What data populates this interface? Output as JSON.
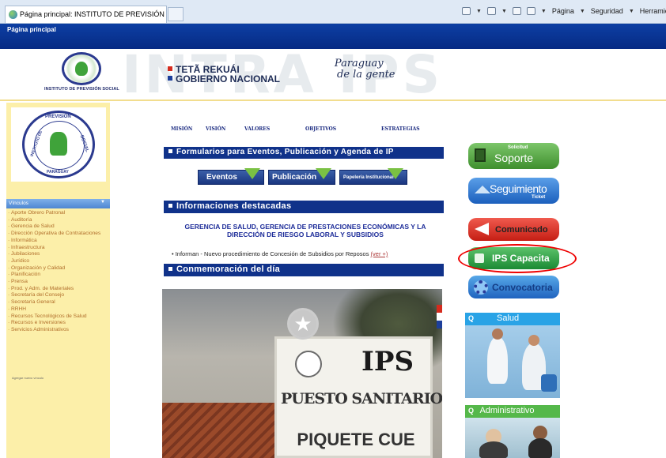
{
  "browser": {
    "tab_title": "Página principal: INSTITUTO DE PREVISIÓN SOCI...",
    "menu": [
      "Página",
      "Seguridad",
      "Herramientas"
    ],
    "frame_title": "Página principal"
  },
  "header": {
    "logo_caption": "INSTITUTO DE PREVISIÓN SOCIAL",
    "watermark": "INTRA IPS",
    "gov_line1": "TETÃ REKUÁI",
    "gov_line2": "GOBIERNO NACIONAL",
    "slogan_line1": "Paraguay",
    "slogan_line2": "de la gente",
    "colors": {
      "red": "#d52b1e",
      "blue": "#1d3f9b"
    }
  },
  "sidebar": {
    "seal_top": "PREVISIÓN",
    "seal_left": "INSTITUTO DE",
    "seal_right": "SOCIAL",
    "seal_bottom": "PARAGUAY",
    "links_title": "Vínculos",
    "links": [
      "Aporte Obrero Patronal",
      "Auditoría",
      "Gerencia de Salud",
      "Dirección Operativa de Contrataciones",
      "Informática",
      "Infraestructura",
      "Jubilaciones",
      "Jurídico",
      "Organización y Calidad",
      "Planificación",
      "Prensa",
      "Prod. y Adm. de Materiales",
      "Secretaría del Consejo",
      "Secretaría General",
      "RRHH",
      "Recursos Tecnológicos de Salud",
      "Recursos e Inversiones",
      "Servicios Administrativos"
    ],
    "add_link": "Agregar nuevo vínculo"
  },
  "nav": {
    "items": [
      "MISIÓN",
      "VISIÓN",
      "VALORES",
      "OBJETIVOS",
      "ESTRATEGIAS"
    ]
  },
  "forms_section": {
    "title": "Formularios para Eventos, Publicación y Agenda de IP",
    "buttons": [
      "Eventos",
      "Publicación",
      "Papelería Institucional"
    ]
  },
  "highlights": {
    "title": "Informaciones destacadas",
    "headline": "GERENCIA DE SALUD, GERENCIA DE PRESTACIONES ECONÓMICAS Y LA DIRECCIÓN DE RIESGO LABORAL Y SUBSIDIOS",
    "bullet": "Informan - Nuevo procedimiento de Concesión de Subsidios por Reposos",
    "more": "(ver +)"
  },
  "commemoration": {
    "title": "Conmemoración del día",
    "photo_ips": "IPS",
    "photo_line1": "PUESTO SANITARIO",
    "photo_line2": "PIQUETE CUE"
  },
  "right": {
    "soporte_small": "Solicitud",
    "soporte": "Soporte",
    "seguimiento": "Seguimiento",
    "seguimiento_small": "Ticket",
    "comunicado": "Comunicado",
    "capacita": "IPS Capacita",
    "convocatoria": "Convocatoria",
    "salud": "Salud",
    "administrativo": "Administrativo",
    "highlight_color": "#e00000"
  }
}
